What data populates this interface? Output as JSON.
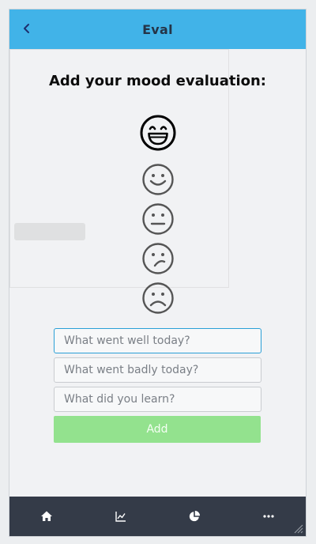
{
  "header": {
    "title": "Eval",
    "back_icon": "chevron-left-icon"
  },
  "main": {
    "heading": "Add your mood evaluation:",
    "moods": [
      {
        "icon": "grinning-face-icon",
        "selected": true
      },
      {
        "icon": "smiling-face-icon",
        "selected": false
      },
      {
        "icon": "neutral-face-icon",
        "selected": false
      },
      {
        "icon": "confused-face-icon",
        "selected": false
      },
      {
        "icon": "frowning-face-icon",
        "selected": false
      }
    ],
    "form": {
      "went_well_placeholder": "What went well today?",
      "went_well_value": "",
      "went_badly_placeholder": "What went badly today?",
      "went_badly_value": "",
      "learned_placeholder": "What did you learn?",
      "learned_value": "",
      "add_label": "Add"
    }
  },
  "tabbar": {
    "items": [
      {
        "icon": "home-icon"
      },
      {
        "icon": "line-chart-icon"
      },
      {
        "icon": "pie-chart-icon"
      },
      {
        "icon": "more-icon"
      }
    ]
  },
  "colors": {
    "header_bg": "#41b3e8",
    "title_text": "#253447",
    "add_button_bg": "#93e28e",
    "tabbar_bg": "#343b48",
    "focus_border": "#2a9fd6"
  }
}
